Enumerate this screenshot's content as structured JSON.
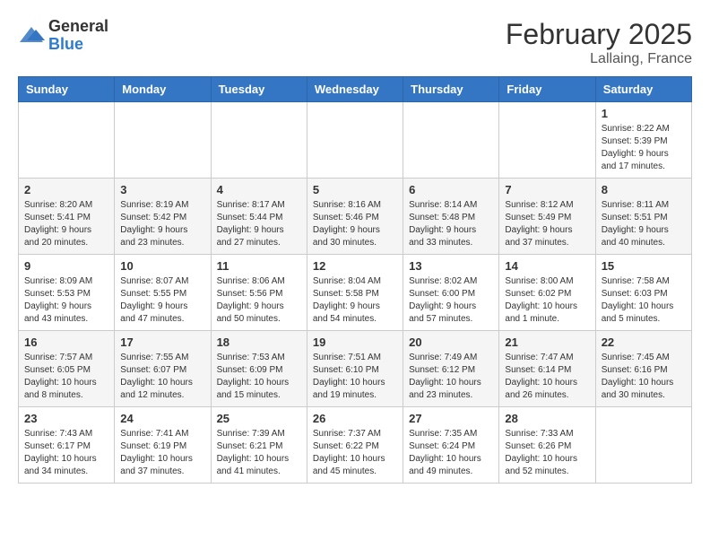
{
  "header": {
    "logo_general": "General",
    "logo_blue": "Blue",
    "month_title": "February 2025",
    "location": "Lallaing, France"
  },
  "days_of_week": [
    "Sunday",
    "Monday",
    "Tuesday",
    "Wednesday",
    "Thursday",
    "Friday",
    "Saturday"
  ],
  "weeks": [
    {
      "days": [
        {
          "num": "",
          "info": ""
        },
        {
          "num": "",
          "info": ""
        },
        {
          "num": "",
          "info": ""
        },
        {
          "num": "",
          "info": ""
        },
        {
          "num": "",
          "info": ""
        },
        {
          "num": "",
          "info": ""
        },
        {
          "num": "1",
          "info": "Sunrise: 8:22 AM\nSunset: 5:39 PM\nDaylight: 9 hours and 17 minutes."
        }
      ]
    },
    {
      "days": [
        {
          "num": "2",
          "info": "Sunrise: 8:20 AM\nSunset: 5:41 PM\nDaylight: 9 hours and 20 minutes."
        },
        {
          "num": "3",
          "info": "Sunrise: 8:19 AM\nSunset: 5:42 PM\nDaylight: 9 hours and 23 minutes."
        },
        {
          "num": "4",
          "info": "Sunrise: 8:17 AM\nSunset: 5:44 PM\nDaylight: 9 hours and 27 minutes."
        },
        {
          "num": "5",
          "info": "Sunrise: 8:16 AM\nSunset: 5:46 PM\nDaylight: 9 hours and 30 minutes."
        },
        {
          "num": "6",
          "info": "Sunrise: 8:14 AM\nSunset: 5:48 PM\nDaylight: 9 hours and 33 minutes."
        },
        {
          "num": "7",
          "info": "Sunrise: 8:12 AM\nSunset: 5:49 PM\nDaylight: 9 hours and 37 minutes."
        },
        {
          "num": "8",
          "info": "Sunrise: 8:11 AM\nSunset: 5:51 PM\nDaylight: 9 hours and 40 minutes."
        }
      ]
    },
    {
      "days": [
        {
          "num": "9",
          "info": "Sunrise: 8:09 AM\nSunset: 5:53 PM\nDaylight: 9 hours and 43 minutes."
        },
        {
          "num": "10",
          "info": "Sunrise: 8:07 AM\nSunset: 5:55 PM\nDaylight: 9 hours and 47 minutes."
        },
        {
          "num": "11",
          "info": "Sunrise: 8:06 AM\nSunset: 5:56 PM\nDaylight: 9 hours and 50 minutes."
        },
        {
          "num": "12",
          "info": "Sunrise: 8:04 AM\nSunset: 5:58 PM\nDaylight: 9 hours and 54 minutes."
        },
        {
          "num": "13",
          "info": "Sunrise: 8:02 AM\nSunset: 6:00 PM\nDaylight: 9 hours and 57 minutes."
        },
        {
          "num": "14",
          "info": "Sunrise: 8:00 AM\nSunset: 6:02 PM\nDaylight: 10 hours and 1 minute."
        },
        {
          "num": "15",
          "info": "Sunrise: 7:58 AM\nSunset: 6:03 PM\nDaylight: 10 hours and 5 minutes."
        }
      ]
    },
    {
      "days": [
        {
          "num": "16",
          "info": "Sunrise: 7:57 AM\nSunset: 6:05 PM\nDaylight: 10 hours and 8 minutes."
        },
        {
          "num": "17",
          "info": "Sunrise: 7:55 AM\nSunset: 6:07 PM\nDaylight: 10 hours and 12 minutes."
        },
        {
          "num": "18",
          "info": "Sunrise: 7:53 AM\nSunset: 6:09 PM\nDaylight: 10 hours and 15 minutes."
        },
        {
          "num": "19",
          "info": "Sunrise: 7:51 AM\nSunset: 6:10 PM\nDaylight: 10 hours and 19 minutes."
        },
        {
          "num": "20",
          "info": "Sunrise: 7:49 AM\nSunset: 6:12 PM\nDaylight: 10 hours and 23 minutes."
        },
        {
          "num": "21",
          "info": "Sunrise: 7:47 AM\nSunset: 6:14 PM\nDaylight: 10 hours and 26 minutes."
        },
        {
          "num": "22",
          "info": "Sunrise: 7:45 AM\nSunset: 6:16 PM\nDaylight: 10 hours and 30 minutes."
        }
      ]
    },
    {
      "days": [
        {
          "num": "23",
          "info": "Sunrise: 7:43 AM\nSunset: 6:17 PM\nDaylight: 10 hours and 34 minutes."
        },
        {
          "num": "24",
          "info": "Sunrise: 7:41 AM\nSunset: 6:19 PM\nDaylight: 10 hours and 37 minutes."
        },
        {
          "num": "25",
          "info": "Sunrise: 7:39 AM\nSunset: 6:21 PM\nDaylight: 10 hours and 41 minutes."
        },
        {
          "num": "26",
          "info": "Sunrise: 7:37 AM\nSunset: 6:22 PM\nDaylight: 10 hours and 45 minutes."
        },
        {
          "num": "27",
          "info": "Sunrise: 7:35 AM\nSunset: 6:24 PM\nDaylight: 10 hours and 49 minutes."
        },
        {
          "num": "28",
          "info": "Sunrise: 7:33 AM\nSunset: 6:26 PM\nDaylight: 10 hours and 52 minutes."
        },
        {
          "num": "",
          "info": ""
        }
      ]
    }
  ]
}
